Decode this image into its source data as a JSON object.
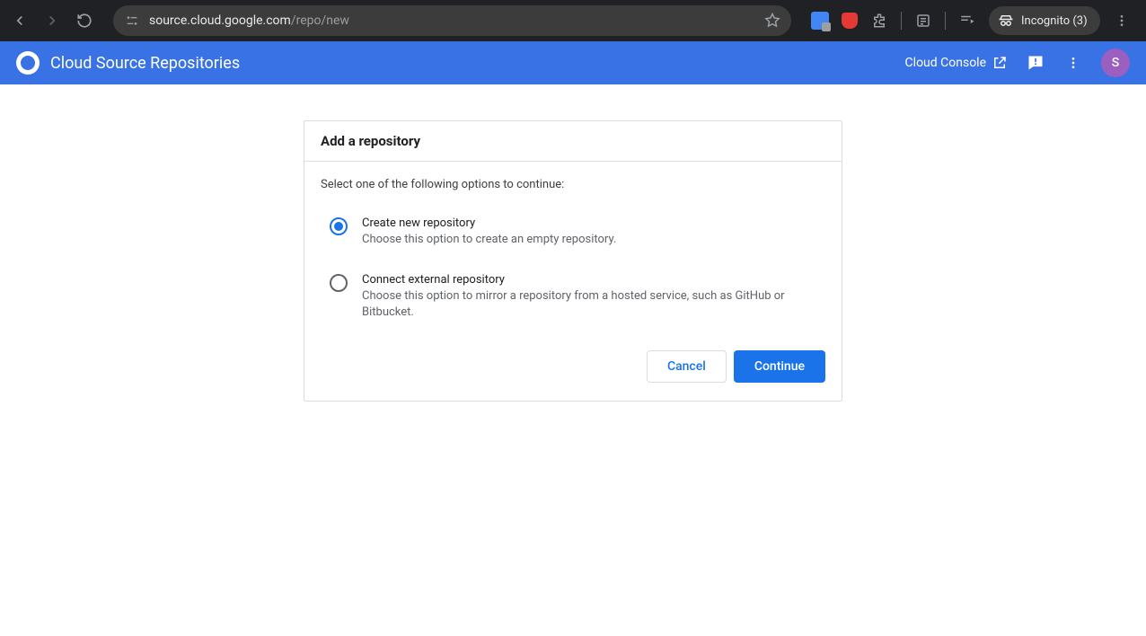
{
  "browser": {
    "url_host": "source.cloud.google.com",
    "url_path": "/repo/new",
    "incognito_label": "Incognito (3)"
  },
  "header": {
    "app_title": "Cloud Source Repositories",
    "console_link": "Cloud Console",
    "avatar_initial": "S"
  },
  "card": {
    "title": "Add a repository",
    "instruction": "Select one of the following options to continue:",
    "options": [
      {
        "title": "Create new repository",
        "desc": "Choose this option to create an empty repository.",
        "selected": true
      },
      {
        "title": "Connect external repository",
        "desc": "Choose this option to mirror a repository from a hosted service, such as GitHub or Bitbucket.",
        "selected": false
      }
    ],
    "cancel_label": "Cancel",
    "continue_label": "Continue"
  }
}
